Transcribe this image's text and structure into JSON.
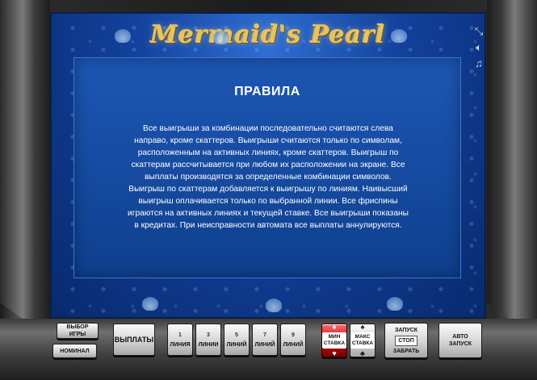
{
  "game": {
    "logo": "Mermaid's Pearl"
  },
  "window_controls": {
    "fullscreen_icon": "fullscreen-icon",
    "sound_icon": "speaker-icon",
    "music_icon": "music-note-icon"
  },
  "rules": {
    "title": "ПРАВИЛА",
    "text": "Все выигрыши за комбинации последовательно считаются слева направо, кроме скаттеров. Выигрыши считаются только по символам, расположенным на активных линиях, кроме скаттеров. Выигрыш по скаттерам рассчитывается при любом их расположении на экране. Все выплаты производятся за определенные комбинации символов. Выигрыш по скаттерам добавляется к выигрышу по линиям. Наивысший выигрыш оплачивается только по выбранной линии. Все фриспины играются на активных линиях и текущей ставке. Все выигрыши показаны в кредитах. При неисправности автомата все выплаты аннулируются."
  },
  "console": {
    "select_game": [
      "ВЫБОР",
      "ИГРЫ"
    ],
    "denomination": "НОМИНАЛ",
    "paytable": "ВЫПЛАТЫ",
    "lines": [
      {
        "num": "1",
        "label": "ЛИНИЯ"
      },
      {
        "num": "3",
        "label": "ЛИНИИ"
      },
      {
        "num": "5",
        "label": "ЛИНИЙ"
      },
      {
        "num": "7",
        "label": "ЛИНИЙ"
      },
      {
        "num": "9",
        "label": "ЛИНИЙ"
      }
    ],
    "min_bet": [
      "МИН",
      "СТАВКА"
    ],
    "max_bet": [
      "МАКС",
      "СТАВКА"
    ],
    "start": [
      "ЗАПУСК",
      "СТОП",
      "ЗАБРАТЬ"
    ],
    "autostart": [
      "АВТО",
      "ЗАПУСК"
    ]
  }
}
